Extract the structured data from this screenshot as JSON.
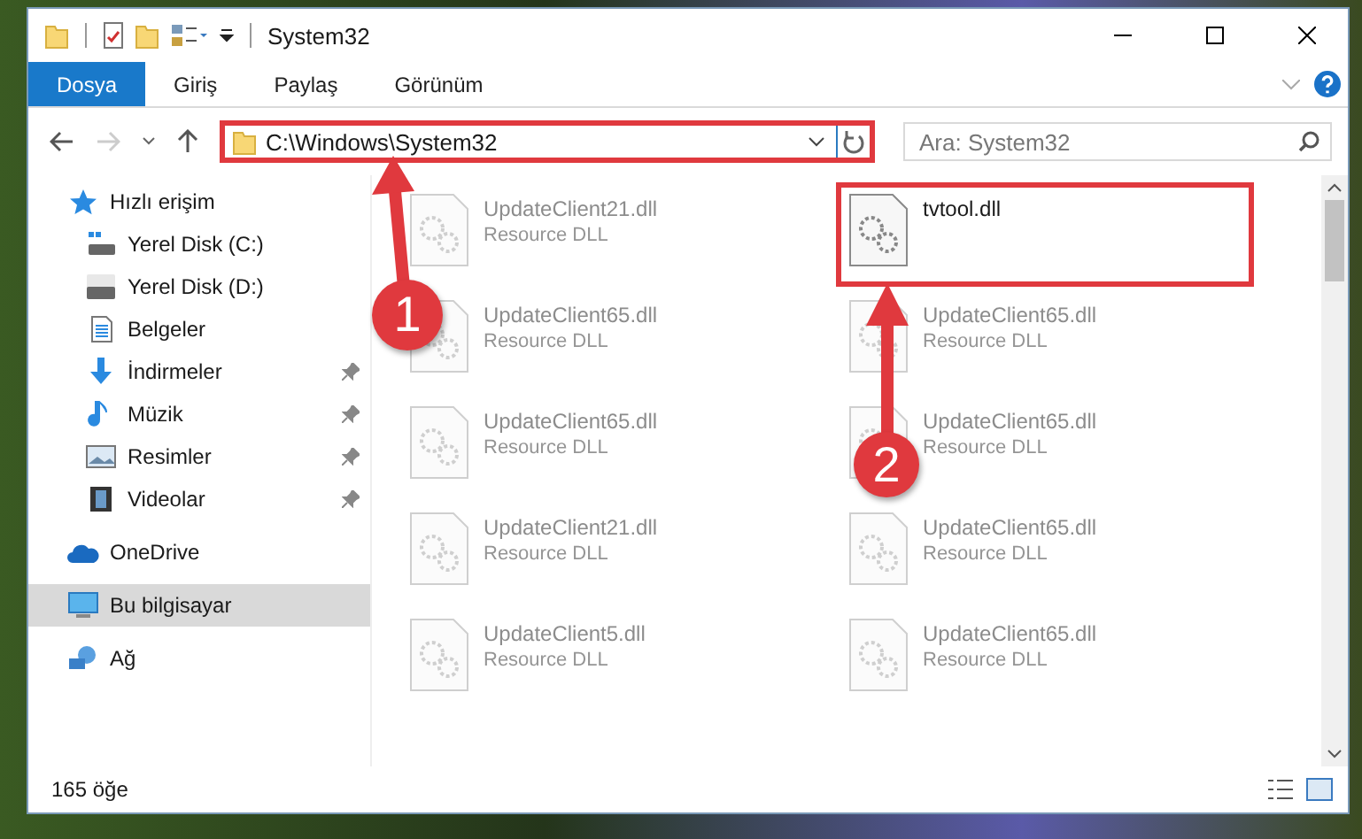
{
  "window": {
    "title": "System32"
  },
  "ribbon_tabs": [
    {
      "label": "Dosya",
      "selected": true
    },
    {
      "label": "Giriş",
      "selected": false
    },
    {
      "label": "Paylaş",
      "selected": false
    },
    {
      "label": "Görünüm",
      "selected": false
    }
  ],
  "address": {
    "path": "C:\\Windows\\System32",
    "highlighted": true
  },
  "search": {
    "placeholder": "Ara: System32"
  },
  "sidebar": {
    "items": [
      {
        "label": "Hızlı erişim",
        "kind": "star",
        "selected": false,
        "children": [
          {
            "label": "Yerel Disk (C:)",
            "kind": "drive-windows",
            "selected": false,
            "pinned": false
          },
          {
            "label": "Yerel Disk (D:)",
            "kind": "drive",
            "selected": false,
            "pinned": false
          },
          {
            "label": "Belgeler",
            "kind": "documents",
            "selected": false,
            "pinned": false
          },
          {
            "label": "İndirmeler",
            "kind": "download",
            "selected": false,
            "pinned": true
          },
          {
            "label": "Müzik",
            "kind": "music",
            "selected": false,
            "pinned": true
          },
          {
            "label": "Resimler",
            "kind": "pictures",
            "selected": false,
            "pinned": true
          },
          {
            "label": "Videolar",
            "kind": "videos",
            "selected": false,
            "pinned": true
          }
        ]
      },
      {
        "label": "OneDrive",
        "kind": "cloud",
        "selected": false
      },
      {
        "label": "Bu bilgisayar",
        "kind": "computer",
        "selected": true
      },
      {
        "label": "Ağ",
        "kind": "network",
        "selected": false
      }
    ]
  },
  "files": [
    {
      "name": "UpdateClient21.dll",
      "type": "Resource DLL",
      "dimmed": true,
      "highlighted": false
    },
    {
      "name": "tvtool.dll",
      "dimmed": false,
      "highlighted": true
    },
    {
      "name": "UpdateClient65.dll",
      "type": "Resource DLL",
      "dimmed": true,
      "highlighted": false
    },
    {
      "name": "UpdateClient65.dll",
      "type": "Resource DLL",
      "dimmed": true,
      "highlighted": false
    },
    {
      "name": "UpdateClient65.dll",
      "type": "Resource DLL",
      "dimmed": true,
      "highlighted": false
    },
    {
      "name": "UpdateClient65.dll",
      "type": "Resource DLL",
      "dimmed": true,
      "highlighted": false
    },
    {
      "name": "UpdateClient21.dll",
      "type": "Resource DLL",
      "dimmed": true,
      "highlighted": false
    },
    {
      "name": "UpdateClient65.dll",
      "type": "Resource DLL",
      "dimmed": true,
      "highlighted": false
    },
    {
      "name": "UpdateClient5.dll",
      "type": "Resource DLL",
      "dimmed": true,
      "highlighted": false
    },
    {
      "name": "UpdateClient65.dll",
      "type": "Resource DLL",
      "dimmed": true,
      "highlighted": false
    }
  ],
  "callouts": [
    {
      "number": "1"
    },
    {
      "number": "2"
    }
  ],
  "status_bar": {
    "count": "165 öğe"
  }
}
